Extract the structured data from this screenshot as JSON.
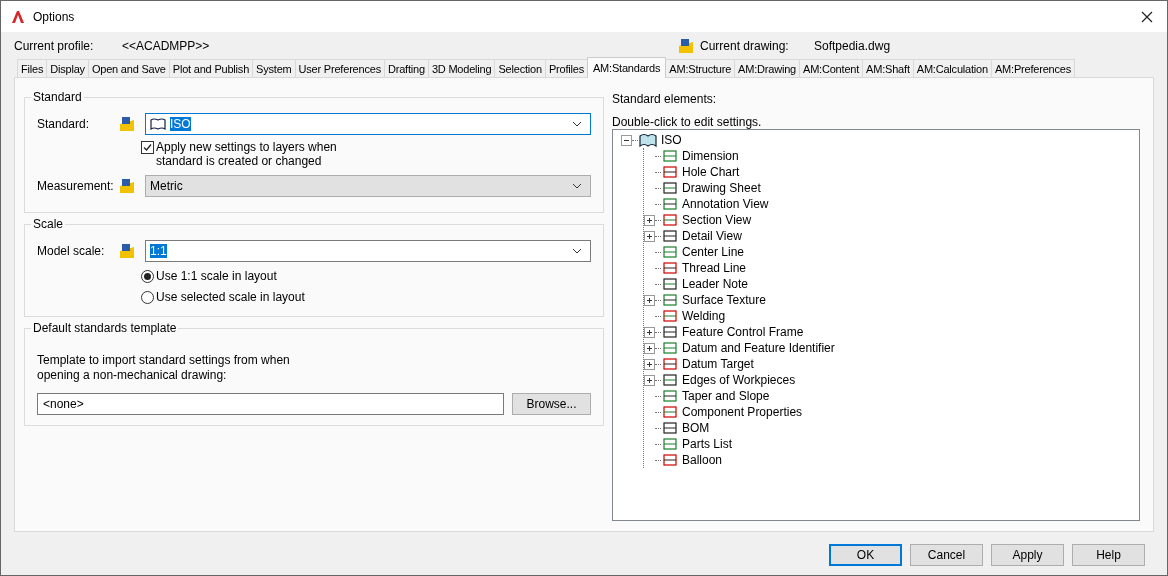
{
  "window": {
    "title": "Options"
  },
  "profile": {
    "label": "Current profile:",
    "value": "<<ACADMPP>>"
  },
  "drawing": {
    "label": "Current drawing:",
    "value": "Softpedia.dwg"
  },
  "tabs": [
    {
      "label": "Files",
      "selected": false
    },
    {
      "label": "Display",
      "selected": false
    },
    {
      "label": "Open and Save",
      "selected": false
    },
    {
      "label": "Plot and Publish",
      "selected": false
    },
    {
      "label": "System",
      "selected": false
    },
    {
      "label": "User Preferences",
      "selected": false
    },
    {
      "label": "Drafting",
      "selected": false
    },
    {
      "label": "3D Modeling",
      "selected": false
    },
    {
      "label": "Selection",
      "selected": false
    },
    {
      "label": "Profiles",
      "selected": false
    },
    {
      "label": "AM:Standards",
      "selected": true
    },
    {
      "label": "AM:Structure",
      "selected": false
    },
    {
      "label": "AM:Drawing",
      "selected": false
    },
    {
      "label": "AM:Content",
      "selected": false
    },
    {
      "label": "AM:Shaft",
      "selected": false
    },
    {
      "label": "AM:Calculation",
      "selected": false
    },
    {
      "label": "AM:Preferences",
      "selected": false
    }
  ],
  "standard_group": {
    "title": "Standard",
    "standard": {
      "label": "Standard:",
      "value": "ISO",
      "disabled": false,
      "text_selected": true
    },
    "checkbox": {
      "label": "Apply new settings to layers when standard is created or changed",
      "checked": true
    },
    "measurement": {
      "label": "Measurement:",
      "value": "Metric",
      "disabled": true,
      "text_selected": false
    }
  },
  "scale_group": {
    "title": "Scale",
    "model_scale": {
      "label": "Model scale:",
      "value": "1:1",
      "disabled": false,
      "text_selected": true
    },
    "radios": [
      {
        "label": "Use 1:1 scale in layout",
        "selected": true
      },
      {
        "label": "Use selected scale in layout",
        "selected": false
      }
    ]
  },
  "template_group": {
    "title": "Default standards template",
    "description": "Template to import standard settings from when opening a non-mechanical drawing:",
    "value": "<none>",
    "browse": "Browse..."
  },
  "elements": {
    "label": "Standard elements:",
    "hint": "Double-click to edit settings.",
    "tree": [
      {
        "label": "ISO",
        "expanded": true,
        "children": [
          {
            "label": "Dimension"
          },
          {
            "label": "Hole Chart"
          },
          {
            "label": "Drawing Sheet"
          },
          {
            "label": "Annotation View"
          },
          {
            "label": "Section View",
            "expanded": false
          },
          {
            "label": "Detail View",
            "expanded": false
          },
          {
            "label": "Center Line"
          },
          {
            "label": "Thread Line"
          },
          {
            "label": "Leader Note"
          },
          {
            "label": "Surface Texture",
            "expanded": false
          },
          {
            "label": "Welding"
          },
          {
            "label": "Feature Control Frame",
            "expanded": false
          },
          {
            "label": "Datum and Feature Identifier",
            "expanded": false
          },
          {
            "label": "Datum Target",
            "expanded": false
          },
          {
            "label": "Edges of Workpieces",
            "expanded": false
          },
          {
            "label": "Taper and Slope"
          },
          {
            "label": "Component Properties"
          },
          {
            "label": "BOM"
          },
          {
            "label": "Parts List"
          },
          {
            "label": "Balloon"
          }
        ]
      }
    ]
  },
  "buttons": [
    {
      "label": "OK",
      "default": true
    },
    {
      "label": "Cancel",
      "default": false
    },
    {
      "label": "Apply",
      "default": false
    },
    {
      "label": "Help",
      "default": false
    }
  ]
}
